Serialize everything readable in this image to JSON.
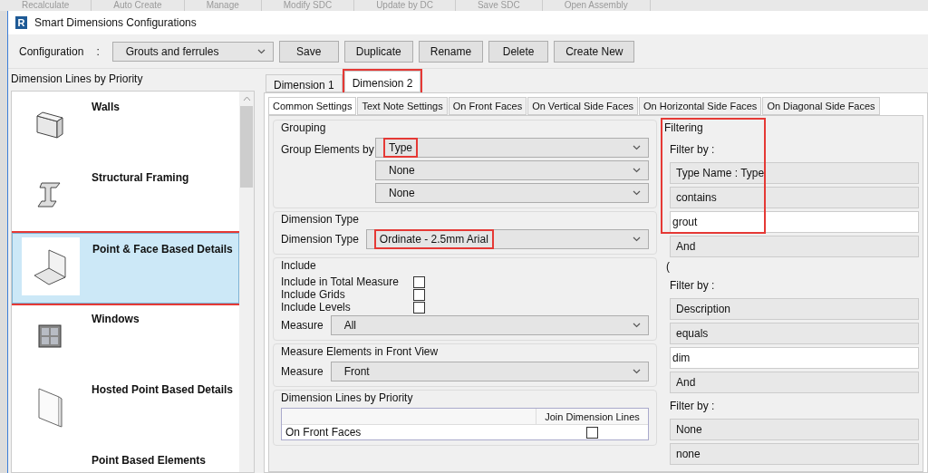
{
  "ribbon": [
    "Recalculate",
    "Auto Create",
    "Manage",
    "Modify SDC",
    "Update by DC",
    "Save SDC",
    "Open Assembly"
  ],
  "window": {
    "title": "Smart Dimensions Configurations",
    "logo": "R"
  },
  "config": {
    "label": "Configuration",
    "separator": ":",
    "value": "Grouts and ferrules",
    "buttons": [
      "Save",
      "Duplicate",
      "Rename",
      "Delete",
      "Create New"
    ]
  },
  "sidebar": {
    "title": "Dimension Lines by Priority",
    "items": [
      {
        "label": "Walls",
        "selected": false,
        "highlighted": false
      },
      {
        "label": "Structural Framing",
        "selected": false,
        "highlighted": false
      },
      {
        "label": "Point & Face Based Details",
        "selected": true,
        "highlighted": true
      },
      {
        "label": "Windows",
        "selected": false,
        "highlighted": false
      },
      {
        "label": "Hosted Point Based Details",
        "selected": false,
        "highlighted": false
      },
      {
        "label": "Point Based Elements",
        "selected": false,
        "highlighted": false
      }
    ]
  },
  "tabs": [
    {
      "label": "Dimension 1",
      "selected": false,
      "highlighted": false
    },
    {
      "label": "Dimension 2",
      "selected": true,
      "highlighted": true
    }
  ],
  "subtabs": [
    {
      "label": "Common Settings",
      "selected": true
    },
    {
      "label": "Text Note Settings",
      "selected": false
    },
    {
      "label": "On Front Faces",
      "selected": false
    },
    {
      "label": "On Vertical Side Faces",
      "selected": false
    },
    {
      "label": "On Horizontal Side Faces",
      "selected": false
    },
    {
      "label": "On Diagonal Side Faces",
      "selected": false
    }
  ],
  "grouping": {
    "title": "Grouping",
    "label": "Group Elements by",
    "selects": [
      {
        "value": "Type",
        "highlighted": true
      },
      {
        "value": "None",
        "highlighted": false
      },
      {
        "value": "None",
        "highlighted": false
      }
    ]
  },
  "dimension_type": {
    "title": "Dimension Type",
    "label": "Dimension Type",
    "value": "Ordinate - 2.5mm Arial",
    "highlighted": true
  },
  "include": {
    "title": "Include",
    "checks": [
      {
        "label": "Include in Total Measure",
        "checked": false
      },
      {
        "label": "Include Grids",
        "checked": false
      },
      {
        "label": "Include Levels",
        "checked": false
      }
    ],
    "measure_label": "Measure",
    "measure_value": "All"
  },
  "front_view": {
    "title": "Measure Elements in Front View",
    "measure_label": "Measure",
    "measure_value": "Front"
  },
  "priority": {
    "title": "Dimension Lines by Priority",
    "column_header": "Join Dimension Lines",
    "rows": [
      {
        "label": "On Front Faces",
        "checked": false
      }
    ]
  },
  "filtering": {
    "title": "Filtering",
    "highlighted": true,
    "rows": [
      {
        "kind": "label",
        "text": "Filter by :"
      },
      {
        "kind": "select",
        "text": "Type Name : Type"
      },
      {
        "kind": "select",
        "text": "contains"
      },
      {
        "kind": "input",
        "text": "grout"
      },
      {
        "kind": "select",
        "text": "And"
      },
      {
        "kind": "text",
        "text": "("
      },
      {
        "kind": "label",
        "text": "Filter by :"
      },
      {
        "kind": "select",
        "text": "Description"
      },
      {
        "kind": "select",
        "text": "equals"
      },
      {
        "kind": "input",
        "text": "dim"
      },
      {
        "kind": "select",
        "text": "And"
      },
      {
        "kind": "label",
        "text": "Filter by :"
      },
      {
        "kind": "select",
        "text": "None"
      },
      {
        "kind": "select",
        "text": "none"
      }
    ]
  }
}
